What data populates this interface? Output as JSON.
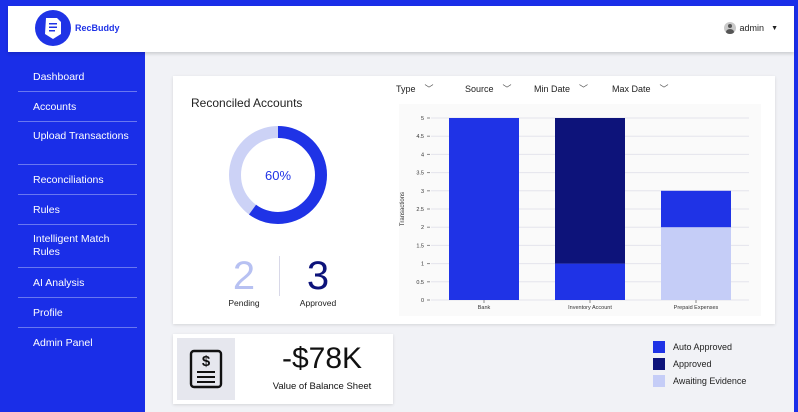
{
  "app": {
    "brand": "RecBuddy"
  },
  "user": {
    "name": "admin"
  },
  "sidebar": {
    "items": [
      {
        "label": "Dashboard"
      },
      {
        "label": "Accounts"
      },
      {
        "label": "Upload Transactions"
      },
      {
        "label": "Reconciliations"
      },
      {
        "label": "Rules"
      },
      {
        "label": "Intelligent Match Rules"
      },
      {
        "label": "AI Analysis"
      },
      {
        "label": "Profile"
      },
      {
        "label": "Admin Panel"
      }
    ]
  },
  "filters": [
    {
      "label": "Type"
    },
    {
      "label": "Source"
    },
    {
      "label": "Min Date"
    },
    {
      "label": "Max Date"
    }
  ],
  "reconciled": {
    "title": "Reconciled Accounts",
    "percent_label": "60%",
    "percent": 0.6,
    "pending_count": "2",
    "pending_label": "Pending",
    "approved_count": "3",
    "approved_label": "Approved"
  },
  "balance": {
    "value": "-$78K",
    "label": "Value of Balance Sheet"
  },
  "colors": {
    "auto_approved": "#1f33e6",
    "approved": "#0d137a",
    "awaiting_evidence": "#c5cdf7",
    "donut_track": "#ccd2f6",
    "pending_number": "#b7c1f2"
  },
  "chart_data": {
    "type": "bar",
    "stacked": true,
    "categories": [
      "Bank",
      "Inventory Account",
      "Prepaid Expenses"
    ],
    "ylabel": "Transactions",
    "ylim": [
      0,
      5
    ],
    "yticks": [
      "0",
      "0.5",
      "1",
      "1.5",
      "2",
      "2.5",
      "3",
      "3.5",
      "4",
      "4.5",
      "5"
    ],
    "series": [
      {
        "name": "Awaiting Evidence",
        "values": [
          0,
          0,
          2
        ]
      },
      {
        "name": "Auto Approved",
        "values": [
          5,
          1,
          1
        ]
      },
      {
        "name": "Approved",
        "values": [
          0,
          4,
          0
        ]
      }
    ],
    "legend": [
      {
        "name": "Auto Approved"
      },
      {
        "name": "Approved"
      },
      {
        "name": "Awaiting Evidence"
      }
    ]
  }
}
